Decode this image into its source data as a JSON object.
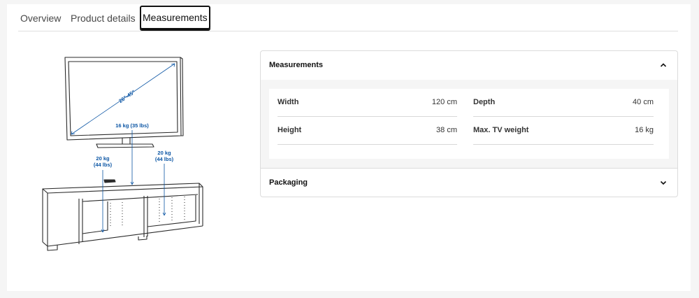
{
  "tabs": [
    {
      "label": "Overview"
    },
    {
      "label": "Product details"
    },
    {
      "label": "Measurements"
    }
  ],
  "illustration": {
    "screen_size": "26\"-45\"",
    "tv_load": "16 kg (35 lbs)",
    "shelf_left_load_kg": "20 kg",
    "shelf_left_load_lbs": "(44 lbs)",
    "shelf_right_load_kg": "20 kg",
    "shelf_right_load_lbs": "(44 lbs)",
    "line_color": "#2b2b2b",
    "annotation_color": "#0b55a4"
  },
  "measurements": {
    "title": "Measurements",
    "expanded_icon": "chevron-up-icon",
    "rows": [
      {
        "label": "Width",
        "value": "120 cm"
      },
      {
        "label": "Depth",
        "value": "40 cm"
      },
      {
        "label": "Height",
        "value": "38 cm"
      },
      {
        "label": "Max. TV weight",
        "value": "16 kg"
      }
    ]
  },
  "packaging": {
    "title": "Packaging",
    "collapsed_icon": "chevron-down-icon"
  }
}
